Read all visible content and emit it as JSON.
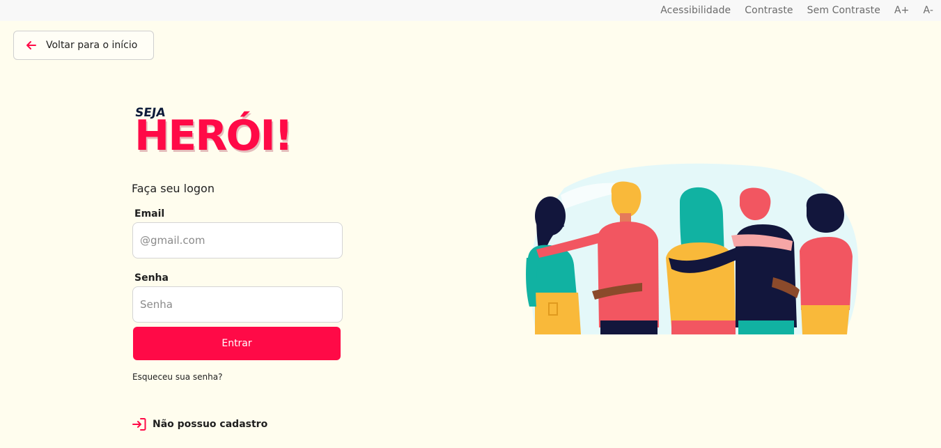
{
  "topbar": {
    "links": [
      "Acessibilidade",
      "Contraste",
      "Sem Contraste",
      "A+",
      "A-"
    ]
  },
  "back_button": {
    "label": "Voltar para o início",
    "icon": "arrow-left-icon"
  },
  "logo": {
    "line1": "SEJA",
    "line2": "HERÓI!"
  },
  "login": {
    "subtitle": "Faça seu logon",
    "email_label": "Email",
    "email_placeholder": "@gmail.com",
    "email_value": "",
    "password_label": "Senha",
    "password_placeholder": "Senha",
    "password_value": "",
    "submit_label": "Entrar",
    "forgot_label": "Esqueceu sua senha?",
    "register_label": "Não possuo cadastro",
    "register_icon": "log-in-icon"
  },
  "colors": {
    "background": "#FFFDEE",
    "accent": "#FF0A47",
    "topbar": "#F8F8F8"
  }
}
